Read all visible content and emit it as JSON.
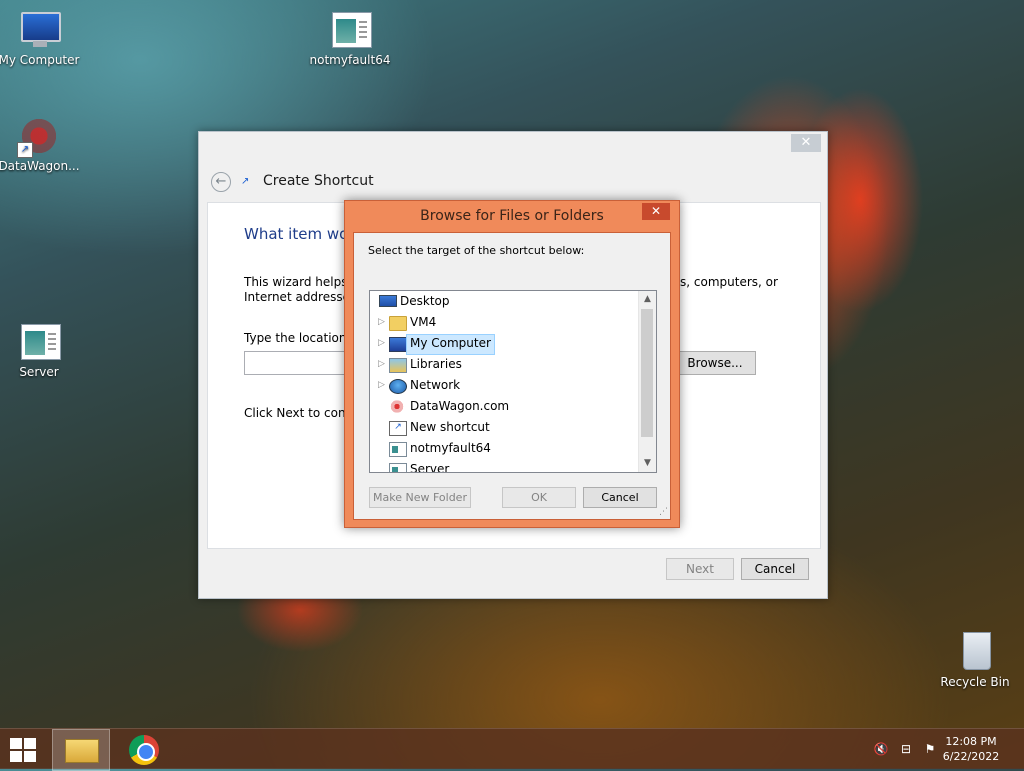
{
  "desktop": {
    "icons": [
      {
        "label": "My Computer"
      },
      {
        "label": "notmyfault64"
      },
      {
        "label": "DataWagon..."
      },
      {
        "label": "Server"
      },
      {
        "label": "Recycle Bin"
      }
    ]
  },
  "wizard": {
    "title": "Create Shortcut",
    "close_label": "✕",
    "heading": "What item wou",
    "intro_line1": "This wizard helps yo",
    "intro_line2": "Internet addresses.",
    "intro_right": "s, computers, or",
    "location_label": "Type the location o",
    "location_value": "",
    "browse_label": "Browse...",
    "next_text": "Click Next to contin",
    "next_label": "Next",
    "cancel_label": "Cancel"
  },
  "browse_dialog": {
    "title": "Browse for Files or Folders",
    "close_label": "✕",
    "prompt": "Select the target of the shortcut below:",
    "tree": [
      {
        "label": "Desktop",
        "icon": "desktop-icon",
        "expandable": false
      },
      {
        "label": "VM4",
        "icon": "folder-icon",
        "expandable": true
      },
      {
        "label": "My Computer",
        "icon": "computer-icon",
        "expandable": true,
        "selected": true
      },
      {
        "label": "Libraries",
        "icon": "libraries-icon",
        "expandable": true
      },
      {
        "label": "Network",
        "icon": "network-icon",
        "expandable": true
      },
      {
        "label": "DataWagon.com",
        "icon": "web-shortcut-icon",
        "expandable": false
      },
      {
        "label": "New shortcut",
        "icon": "shortcut-icon",
        "expandable": false
      },
      {
        "label": "notmyfault64",
        "icon": "app-icon",
        "expandable": false
      },
      {
        "label": "Server",
        "icon": "app-icon",
        "expandable": false
      }
    ],
    "new_folder_label": "Make New Folder",
    "ok_label": "OK",
    "cancel_label": "Cancel"
  },
  "taskbar": {
    "time": "12:08 PM",
    "date": "6/22/2022"
  },
  "colors": {
    "dialog_accent": "#f08a5a",
    "close_red": "#c84a2d",
    "heading_blue": "#1f3d8a",
    "selection": "#cce8ff"
  }
}
